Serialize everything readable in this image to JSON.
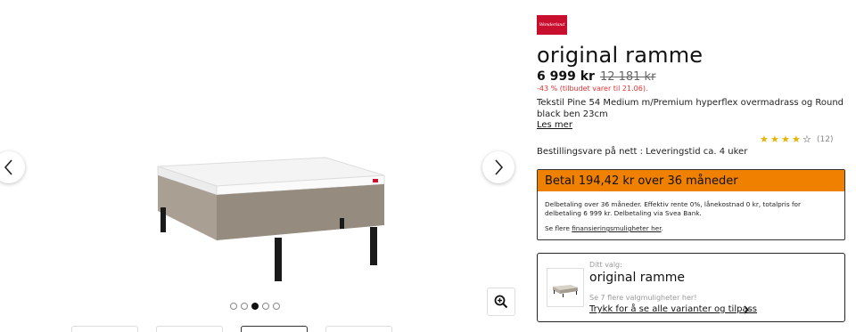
{
  "brand": {
    "logo_text": "Wonderland",
    "color": "#c8102e"
  },
  "product": {
    "title": "original ramme",
    "price": "6 999 kr",
    "old_price": "12 181 kr",
    "discount": "-43 % (tilbudet varer til 21.06).",
    "description": "Tekstil Pine 54 Medium m/Premium hyperflex overmadrass og Round black ben 23cm",
    "read_more": "Les mer",
    "rating_stars": 4.5,
    "rating_count": "(12)",
    "delivery": "Bestillingsvare på nett : Leveringstid ca. 4 uker"
  },
  "finance": {
    "headline": "Betal 194,42 kr over 36 måneder",
    "accent_color": "#f08000",
    "details": "Delbetaling over 36 måneder. Effektiv rente 0%, lånekostnad 0 kr, totalpris for delbetaling 6 999 kr. Delbetaling via Svea Bank.",
    "more_prefix": "Se flere ",
    "more_link": "finansieringsmuligheter her",
    "more_suffix": "."
  },
  "choice": {
    "label": "Ditt valg:",
    "name": "original ramme",
    "more": "Se 7 flere valgmuligheter her!",
    "link": "Trykk for å se alle varianter og tilpass"
  },
  "gallery": {
    "active_slide": 3,
    "slide_count": 5,
    "icons": {
      "prev": "chevron-left-icon",
      "next": "chevron-right-icon",
      "zoom": "zoom-in-icon"
    }
  }
}
